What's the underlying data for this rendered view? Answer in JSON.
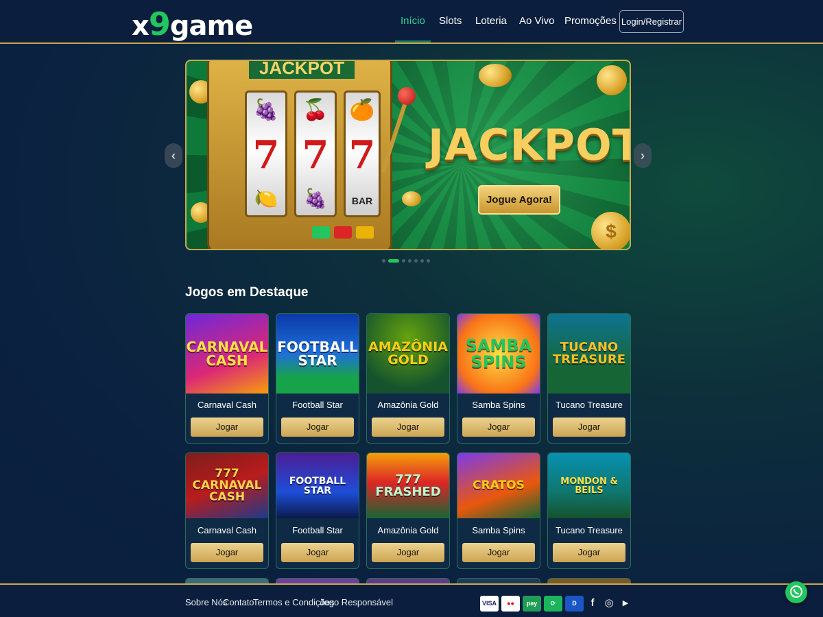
{
  "brand": {
    "logo_x": "x",
    "logo_nine": "9",
    "logo_game": "game"
  },
  "nav": {
    "items": [
      {
        "label": "Início",
        "active": true
      },
      {
        "label": "Slots",
        "active": false
      },
      {
        "label": "Loteria",
        "active": false
      },
      {
        "label": "Ao Vivo",
        "active": false
      },
      {
        "label": "Promoções",
        "active": false
      }
    ],
    "login_label": "Login/Registrar"
  },
  "banner": {
    "slot_sign": "JACKPOT",
    "title": "JACKPOT",
    "cta_label": "Jogue Agora!",
    "reel_symbols": [
      {
        "top": "🍇",
        "mid": "7",
        "bot": "🍋"
      },
      {
        "top": "🍒",
        "mid": "7",
        "bot": "🍇"
      },
      {
        "top": "🍊",
        "mid": "7",
        "bot": "BAR"
      }
    ],
    "prev_icon": "‹",
    "next_icon": "›",
    "slide_count": 7,
    "active_slide": 2
  },
  "featured": {
    "title": "Jogos em Destaque",
    "play_label": "Jogar",
    "row1": [
      {
        "name": "Carnaval Cash",
        "art_text": "CARNAVAL CASH"
      },
      {
        "name": "Football Star",
        "art_text": "FOOTBALL STAR"
      },
      {
        "name": "Amazônia Gold",
        "art_text": "AMAZÔNIA GOLD"
      },
      {
        "name": "Samba Spins",
        "art_text": "SAMBA SPINS"
      },
      {
        "name": "Tucano Treasure",
        "art_text": "TUCANO TREASURE"
      }
    ],
    "row2": [
      {
        "name": "Carnaval Cash",
        "art_text": "777 CARNAVAL CASH"
      },
      {
        "name": "Football Star",
        "art_text": "FOOTBALL STAR"
      },
      {
        "name": "Amazônia Gold",
        "art_text": "777 FRASHED"
      },
      {
        "name": "Samba Spins",
        "art_text": "CRATOS"
      },
      {
        "name": "Tucano Treasure",
        "art_text": "MONDON & BEILS"
      }
    ]
  },
  "footer": {
    "links": [
      "Sobre Nós",
      "Contato",
      "Termos e Condições",
      "Jogo Responsável"
    ],
    "payments": [
      {
        "label": "VISA",
        "bg": "#ffffff",
        "fg": "#1a1f71"
      },
      {
        "label": "●●",
        "bg": "#ffffff",
        "fg": "#eb001b"
      },
      {
        "label": "pay",
        "bg": "#1f9d55",
        "fg": "#ffffff"
      },
      {
        "label": "⟳",
        "bg": "#1bb55c",
        "fg": "#ffffff"
      },
      {
        "label": "D",
        "bg": "#1a57c4",
        "fg": "#ffffff"
      }
    ],
    "social_icons": [
      "f",
      "◎",
      "▶"
    ]
  },
  "colors": {
    "accent_gold": "#c9a94e",
    "accent_green": "#34d399",
    "bg_navy": "#0b1e3d"
  }
}
